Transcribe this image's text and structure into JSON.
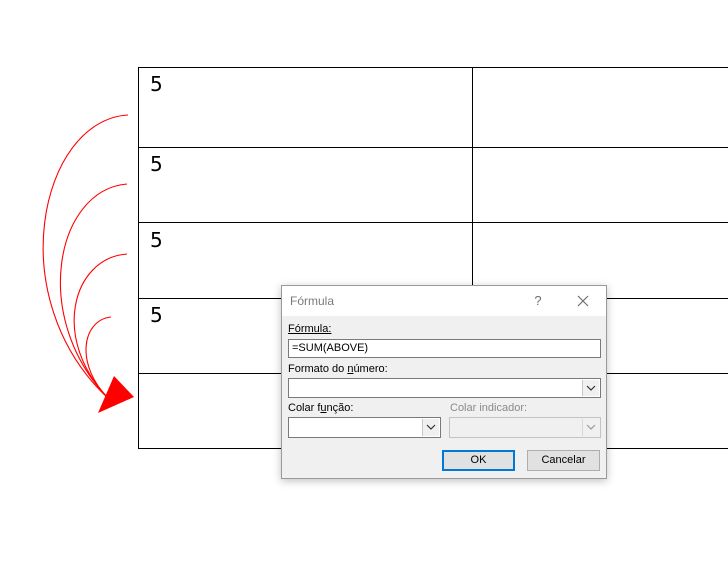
{
  "table": {
    "cells": [
      "5",
      "5",
      "5",
      "5"
    ]
  },
  "dialog": {
    "title": "Fórmula",
    "help_symbol": "?",
    "formula_label": "Fórmula:",
    "formula_value": "=SUM(ABOVE)",
    "number_format_label_pre": "Formato do ",
    "number_format_label_ul": "n",
    "number_format_label_post": "úmero:",
    "number_format_value": "",
    "paste_function_label_pre": "Colar f",
    "paste_function_label_ul": "u",
    "paste_function_label_post": "nção:",
    "paste_bookmark_label": "Colar indicador:",
    "ok_label": "OK",
    "cancel_label": "Cancelar"
  },
  "colors": {
    "annotation_arrow": "#ff0000",
    "ok_focus_border": "#0078d7"
  },
  "icons": {
    "close": "close-icon",
    "dropdown": "chevron-down-icon"
  }
}
